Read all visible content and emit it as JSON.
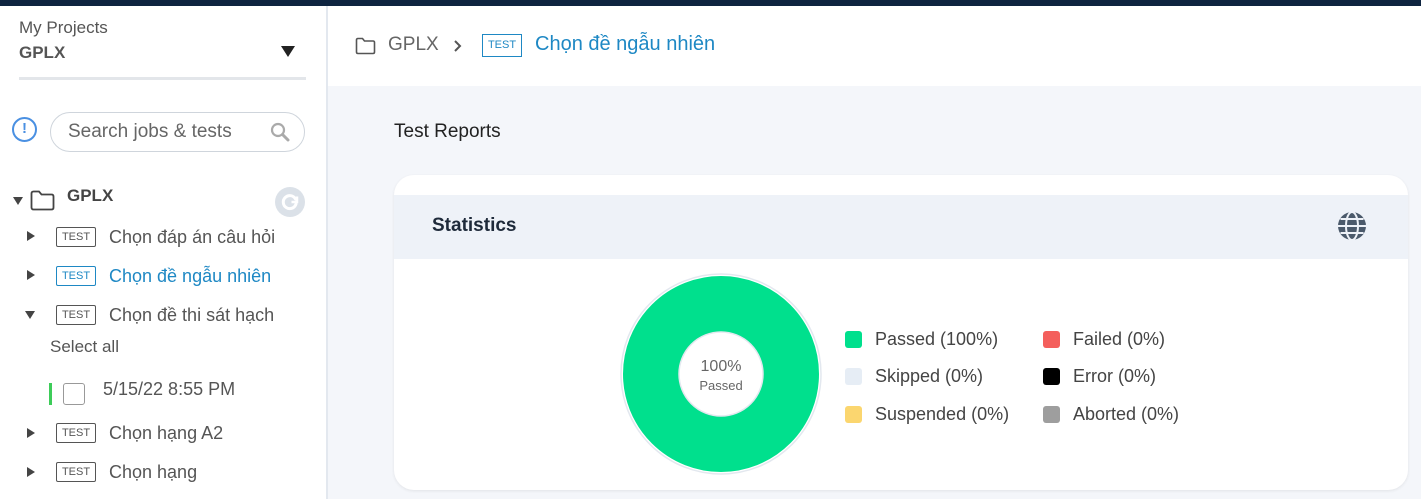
{
  "project": {
    "label": "My Projects",
    "name": "GPLX"
  },
  "search": {
    "placeholder": "Search jobs & tests"
  },
  "tree": {
    "root": "GPLX",
    "items": [
      {
        "badge": "TEST",
        "label": "Chọn đáp án câu hỏi",
        "expanded": false,
        "active": false
      },
      {
        "badge": "TEST",
        "label": "Chọn đề ngẫu nhiên",
        "expanded": false,
        "active": true
      },
      {
        "badge": "TEST",
        "label": "Chọn đề thi sát hạch",
        "expanded": true,
        "active": false
      },
      {
        "badge": "TEST",
        "label": "Chọn hạng A2",
        "expanded": false,
        "active": false
      },
      {
        "badge": "TEST",
        "label": "Chọn hạng",
        "expanded": false,
        "active": false
      }
    ],
    "select_all": "Select all",
    "run_date": "5/15/22 8:55 PM"
  },
  "breadcrumb": {
    "folder": "GPLX",
    "badge": "TEST",
    "test": "Chọn đề ngẫu nhiên"
  },
  "main": {
    "section_title": "Test Reports"
  },
  "statistics": {
    "title": "Statistics",
    "center_value": "100%",
    "center_label": "Passed",
    "legend": [
      {
        "label": "Passed (100%)",
        "color": "#00e08d",
        "percent": 100
      },
      {
        "label": "Skipped (0%)",
        "color": "#e6edf5",
        "percent": 0
      },
      {
        "label": "Suspended (0%)",
        "color": "#fbd66f",
        "percent": 0
      },
      {
        "label": "Failed (0%)",
        "color": "#f45f5c",
        "percent": 0
      },
      {
        "label": "Error (0%)",
        "color": "#000000",
        "percent": 0
      },
      {
        "label": "Aborted (0%)",
        "color": "#9e9e9e",
        "percent": 0
      }
    ]
  },
  "colors": {
    "accent": "#1e88c4",
    "topbar": "#0e2440",
    "passed": "#00e08d"
  }
}
